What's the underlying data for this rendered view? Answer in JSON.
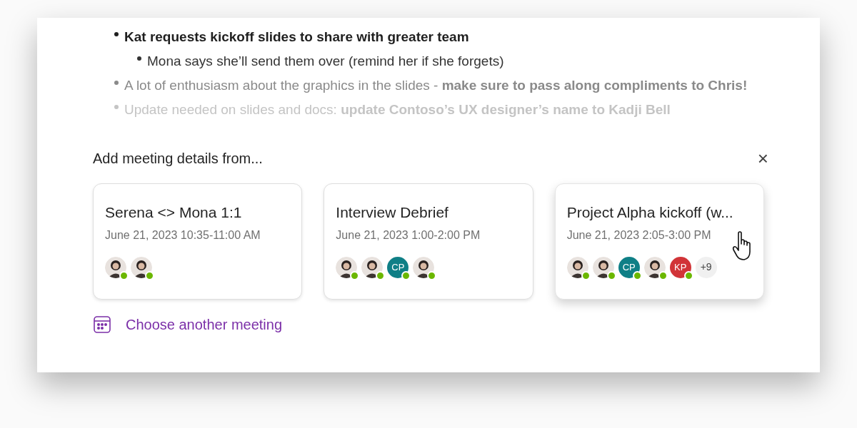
{
  "notes": [
    {
      "text": "Kat requests kickoff slides to share with greater team",
      "bold": true,
      "children": [
        {
          "text": "Mona says she’ll send them over (remind her if she forgets)",
          "bold": false
        }
      ]
    },
    {
      "text": "A lot of enthusiasm about the graphics in the slides - **make sure to pass along compliments to Chris!**",
      "bold": false
    },
    {
      "text": "Update needed on slides and docs: **update Contoso’s UX designer’s name to Kadji Bell**",
      "bold": false
    }
  ],
  "panel": {
    "title": "Add meeting details from...",
    "close": "×",
    "meetings": [
      {
        "title": "Serena <> Mona 1:1",
        "time": "June 21, 2023 10:35-11:00 AM",
        "hovered": false,
        "attendees": [
          {
            "kind": "photo",
            "available": true
          },
          {
            "kind": "photo",
            "available": true
          }
        ]
      },
      {
        "title": "Interview Debrief",
        "time": "June 21, 2023 1:00-2:00 PM",
        "hovered": false,
        "attendees": [
          {
            "kind": "photo",
            "available": true
          },
          {
            "kind": "photo",
            "available": true
          },
          {
            "kind": "initials",
            "initials": "CP",
            "color": "#0f7f86",
            "available": true
          },
          {
            "kind": "photo",
            "available": true
          }
        ]
      },
      {
        "title": "Project Alpha kickoff (w...",
        "time": "June 21, 2023 2:05-3:00 PM",
        "hovered": true,
        "attendees": [
          {
            "kind": "photo",
            "available": true
          },
          {
            "kind": "photo",
            "available": true
          },
          {
            "kind": "initials",
            "initials": "CP",
            "color": "#0f7f86",
            "available": true
          },
          {
            "kind": "photo",
            "available": true
          },
          {
            "kind": "initials",
            "initials": "KP",
            "color": "#d13438",
            "available": true
          },
          {
            "kind": "more",
            "label": "+9"
          }
        ]
      }
    ],
    "link": "Choose another meeting"
  }
}
